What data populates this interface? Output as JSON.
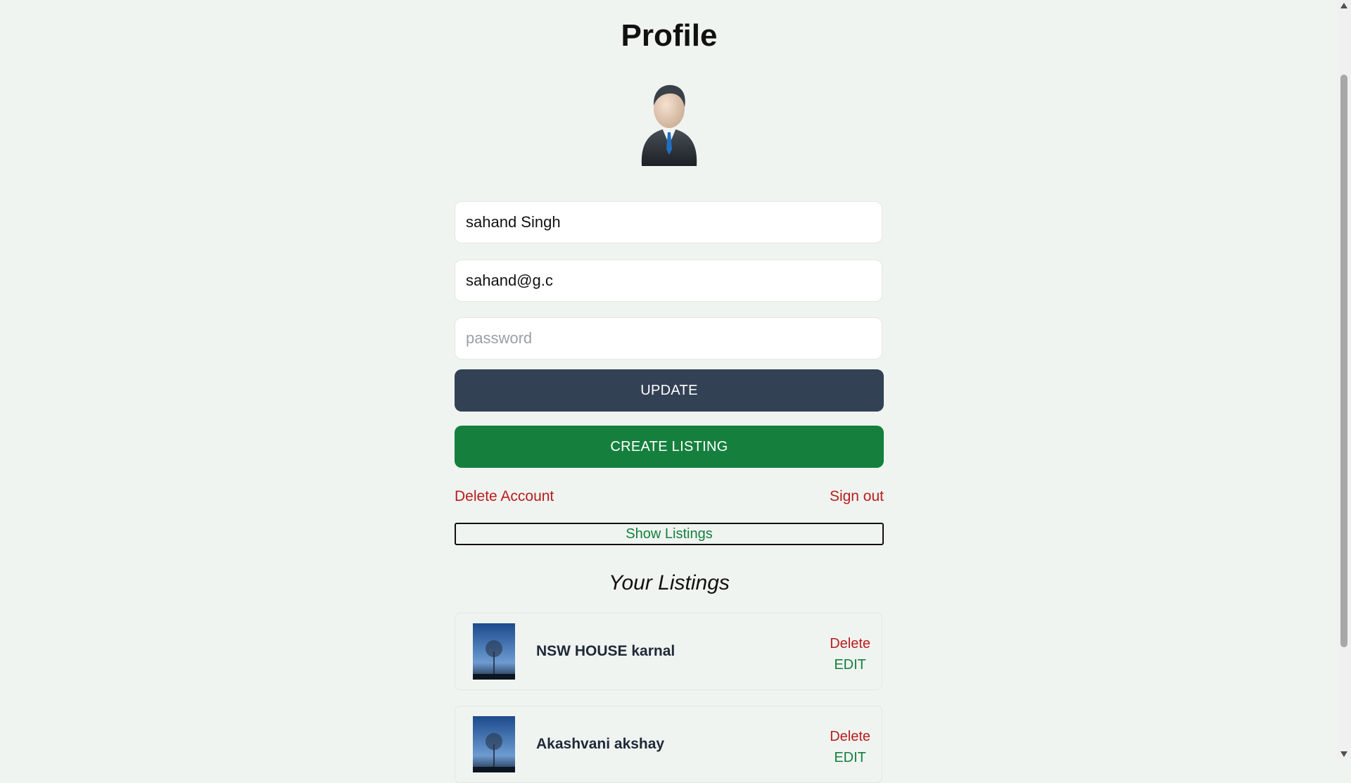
{
  "profile": {
    "title": "Profile",
    "avatar_icon": "businessman-avatar-icon",
    "name_value": "sahand Singh",
    "email_value": "sahand@g.c",
    "password_placeholder": "password"
  },
  "actions": {
    "update_label": "UPDATE",
    "create_listing_label": "CREATE LISTING",
    "delete_account_label": "Delete Account",
    "sign_out_label": "Sign out",
    "show_listings_label": "Show Listings"
  },
  "listings": {
    "heading": "Your Listings",
    "items": [
      {
        "name": "NSW HOUSE karnal",
        "delete_label": "Delete",
        "edit_label": "EDIT"
      },
      {
        "name": "Akashvani akshay",
        "delete_label": "Delete",
        "edit_label": "EDIT"
      }
    ]
  },
  "colors": {
    "background": "#f0f4f1",
    "update_button": "#334155",
    "create_button": "#15803d",
    "danger_text": "#b91c1c",
    "success_text": "#15803d"
  }
}
